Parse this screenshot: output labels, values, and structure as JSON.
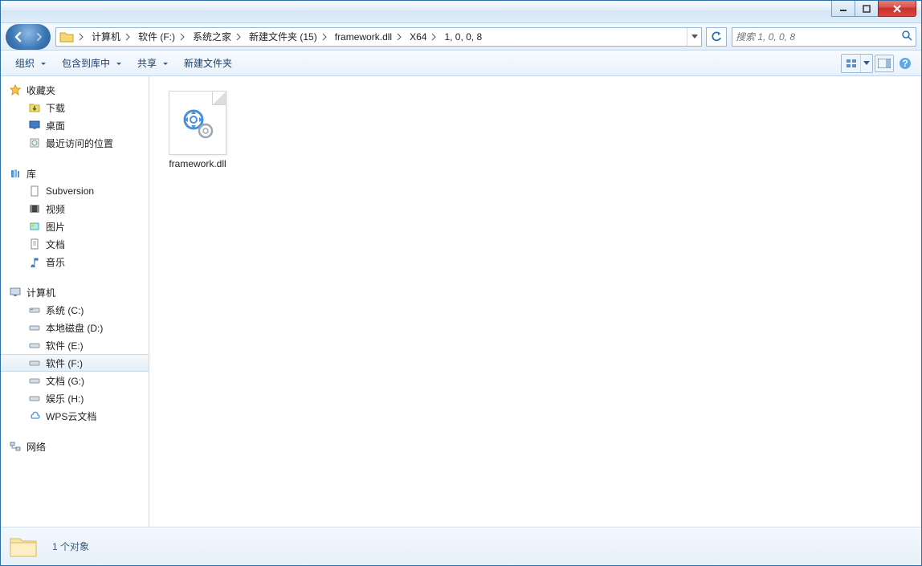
{
  "breadcrumb": [
    {
      "label": "计算机"
    },
    {
      "label": "软件 (F:)"
    },
    {
      "label": "系统之家"
    },
    {
      "label": "新建文件夹 (15)"
    },
    {
      "label": "framework.dll"
    },
    {
      "label": "X64"
    },
    {
      "label": "1, 0, 0, 8"
    }
  ],
  "search": {
    "placeholder": "搜索 1, 0, 0, 8"
  },
  "toolbar": {
    "organize": "组织",
    "include": "包含到库中",
    "share": "共享",
    "newfolder": "新建文件夹"
  },
  "sidebar": {
    "favorites": {
      "header": "收藏夹",
      "items": [
        "下载",
        "桌面",
        "最近访问的位置"
      ]
    },
    "libraries": {
      "header": "库",
      "items": [
        "Subversion",
        "视频",
        "图片",
        "文档",
        "音乐"
      ]
    },
    "computer": {
      "header": "计算机",
      "items": [
        "系统 (C:)",
        "本地磁盘 (D:)",
        "软件 (E:)",
        "软件 (F:)",
        "文档 (G:)",
        "娱乐 (H:)",
        "WPS云文档"
      ],
      "selected_index": 3
    },
    "network": {
      "header": "网络"
    }
  },
  "content": {
    "files": [
      {
        "name": "framework.dll"
      }
    ]
  },
  "statusbar": {
    "text": "1 个对象"
  }
}
